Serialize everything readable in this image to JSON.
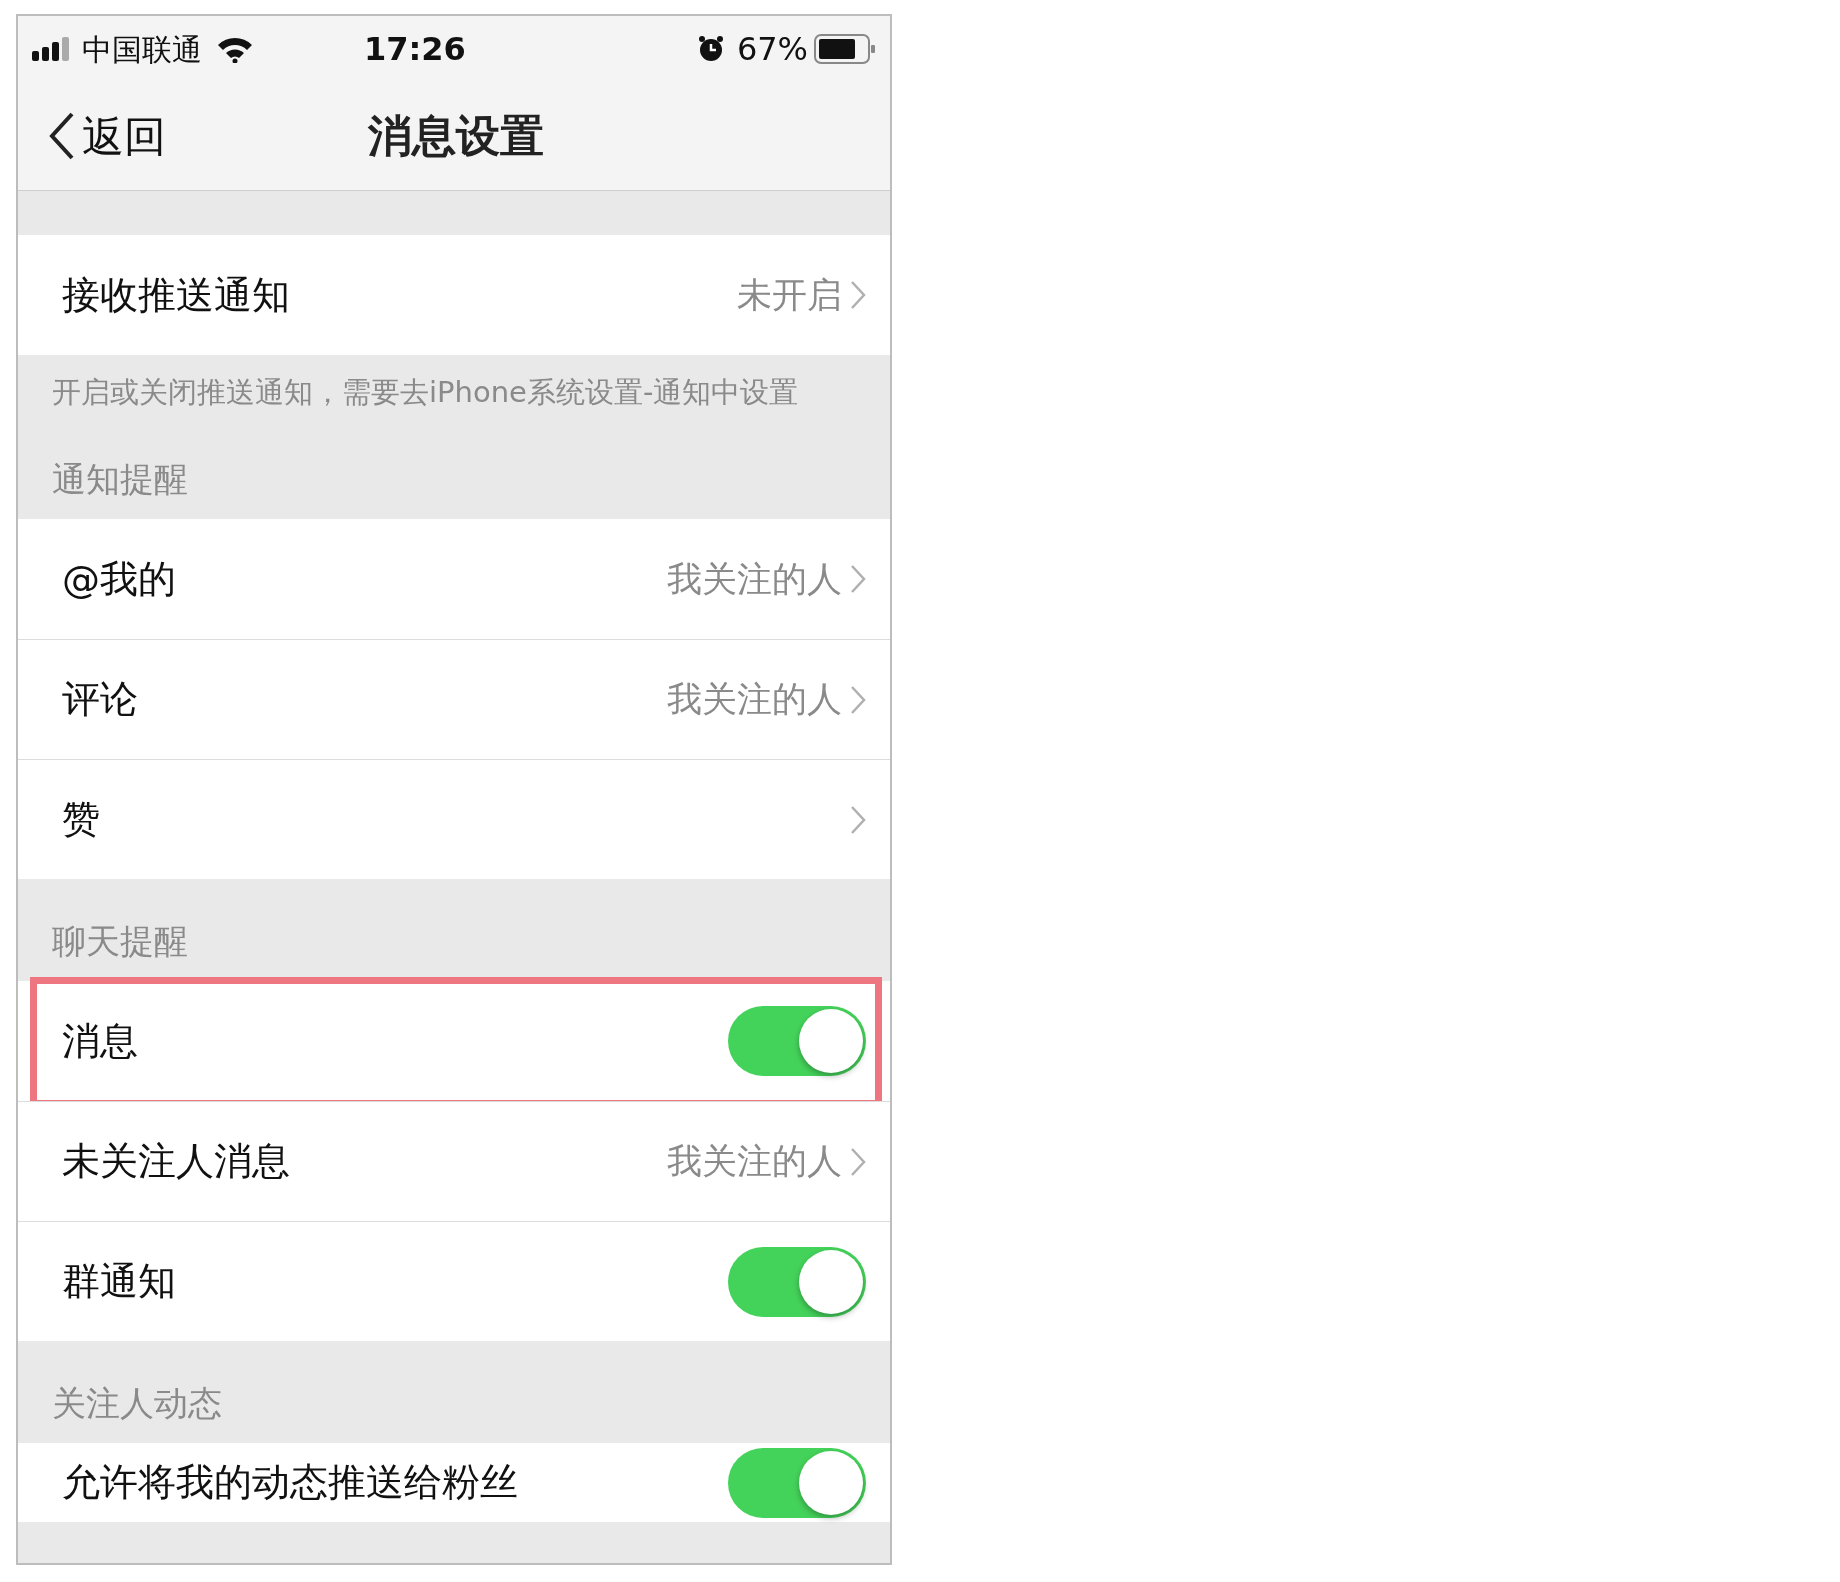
{
  "status_bar": {
    "carrier": "中国联通",
    "time": "17:26",
    "battery": "67%"
  },
  "nav": {
    "back": "返回",
    "title": "消息设置"
  },
  "sections": [
    {
      "rows": [
        {
          "kind": "link",
          "label": "接收推送通知",
          "value": "未开启",
          "highlighted": false
        }
      ],
      "footer": "开启或关闭推送通知，需要去iPhone系统设置-通知中设置"
    },
    {
      "header": "通知提醒",
      "rows": [
        {
          "kind": "link",
          "label": "@我的",
          "value": "我关注的人",
          "highlighted": false
        },
        {
          "kind": "link",
          "label": "评论",
          "value": "我关注的人",
          "highlighted": false
        },
        {
          "kind": "link",
          "label": "赞",
          "highlighted": false
        }
      ]
    },
    {
      "header": "聊天提醒",
      "rows": [
        {
          "kind": "toggle",
          "label": "消息",
          "on": true,
          "highlighted": true
        },
        {
          "kind": "link",
          "label": "未关注人消息",
          "value": "我关注的人",
          "highlighted": false
        },
        {
          "kind": "toggle",
          "label": "群通知",
          "on": true,
          "highlighted": false
        }
      ]
    },
    {
      "header": "关注人动态",
      "rows": [
        {
          "kind": "toggle",
          "label": "允许将我的动态推送给粉丝",
          "on": true,
          "highlighted": false
        }
      ]
    }
  ]
}
